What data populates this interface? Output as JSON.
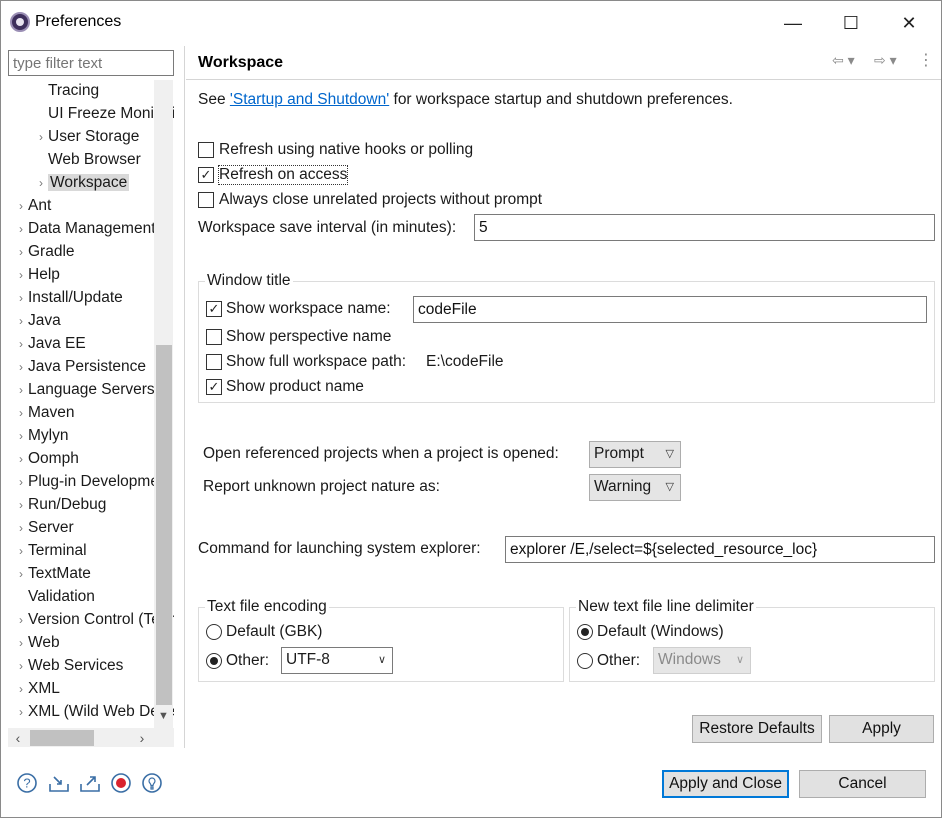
{
  "window": {
    "title": "Preferences",
    "minimize": "—",
    "maximize": "☐",
    "close": "✕"
  },
  "filter": {
    "placeholder": "type filter text"
  },
  "tree": [
    {
      "label": "Tracing",
      "level": 1,
      "arrow": ""
    },
    {
      "label": "UI Freeze Monitoring",
      "level": 1,
      "arrow": ""
    },
    {
      "label": "User Storage",
      "level": 1,
      "arrow": "›"
    },
    {
      "label": "Web Browser",
      "level": 1,
      "arrow": ""
    },
    {
      "label": "Workspace",
      "level": 1,
      "arrow": "›",
      "selected": true
    },
    {
      "label": "Ant",
      "level": 0,
      "arrow": "›"
    },
    {
      "label": "Data Management",
      "level": 0,
      "arrow": "›"
    },
    {
      "label": "Gradle",
      "level": 0,
      "arrow": "›"
    },
    {
      "label": "Help",
      "level": 0,
      "arrow": "›"
    },
    {
      "label": "Install/Update",
      "level": 0,
      "arrow": "›"
    },
    {
      "label": "Java",
      "level": 0,
      "arrow": "›"
    },
    {
      "label": "Java EE",
      "level": 0,
      "arrow": "›"
    },
    {
      "label": "Java Persistence",
      "level": 0,
      "arrow": "›"
    },
    {
      "label": "Language Servers",
      "level": 0,
      "arrow": "›"
    },
    {
      "label": "Maven",
      "level": 0,
      "arrow": "›"
    },
    {
      "label": "Mylyn",
      "level": 0,
      "arrow": "›"
    },
    {
      "label": "Oomph",
      "level": 0,
      "arrow": "›"
    },
    {
      "label": "Plug-in Development",
      "level": 0,
      "arrow": "›"
    },
    {
      "label": "Run/Debug",
      "level": 0,
      "arrow": "›"
    },
    {
      "label": "Server",
      "level": 0,
      "arrow": "›"
    },
    {
      "label": "Terminal",
      "level": 0,
      "arrow": "›"
    },
    {
      "label": "TextMate",
      "level": 0,
      "arrow": "›"
    },
    {
      "label": "Validation",
      "level": 0,
      "arrow": ""
    },
    {
      "label": "Version Control (Team)",
      "level": 0,
      "arrow": "›"
    },
    {
      "label": "Web",
      "level": 0,
      "arrow": "›"
    },
    {
      "label": "Web Services",
      "level": 0,
      "arrow": "›"
    },
    {
      "label": "XML",
      "level": 0,
      "arrow": "›"
    },
    {
      "label": "XML (Wild Web Developer)",
      "level": 0,
      "arrow": "›"
    }
  ],
  "page": {
    "heading": "Workspace",
    "see_prefix": "See ",
    "see_link": "'Startup and Shutdown'",
    "see_suffix": " for workspace startup and shutdown preferences.",
    "refresh_native": {
      "label": "Refresh using native hooks or polling",
      "checked": false
    },
    "refresh_access": {
      "label": "Refresh on access",
      "checked": true
    },
    "close_unrelated": {
      "label": "Always close unrelated projects without prompt",
      "checked": false
    },
    "save_interval": {
      "label": "Workspace save interval (in minutes):",
      "value": "5"
    },
    "window_title": {
      "group_label": "Window title",
      "show_workspace_name": {
        "label": "Show workspace name:",
        "checked": true,
        "value": "codeFile"
      },
      "show_perspective_name": {
        "label": "Show perspective name",
        "checked": false
      },
      "show_full_path": {
        "label": "Show full workspace path:",
        "checked": false,
        "path": "E:\\codeFile"
      },
      "show_product_name": {
        "label": "Show product name",
        "checked": true
      }
    },
    "open_referenced": {
      "label": "Open referenced projects when a project is opened:",
      "value": "Prompt"
    },
    "report_unknown": {
      "label": "Report unknown project nature as:",
      "value": "Warning"
    },
    "command_explorer": {
      "label": "Command for launching system explorer:",
      "value": "explorer /E,/select=${selected_resource_loc}"
    },
    "text_encoding": {
      "group_label": "Text file encoding",
      "default_label": "Default (GBK)",
      "other_label": "Other:",
      "other_value": "UTF-8",
      "selected": "other"
    },
    "line_delimiter": {
      "group_label": "New text file line delimiter",
      "default_label": "Default (Windows)",
      "other_label": "Other:",
      "other_value": "Windows",
      "selected": "default"
    },
    "restore_defaults": "Restore Defaults",
    "apply": "Apply"
  },
  "footer": {
    "apply_close": "Apply and Close",
    "cancel": "Cancel",
    "icons": [
      "help-icon",
      "import-icon",
      "export-icon",
      "record-icon",
      "tip-icon"
    ]
  }
}
